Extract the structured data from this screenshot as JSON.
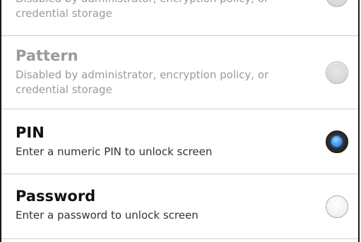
{
  "options": [
    {
      "title": "",
      "summary_line1": "Disabled by administrator, encryption policy, or",
      "summary_line2": "credential storage",
      "state": "disabled"
    },
    {
      "title": "Pattern",
      "summary_line1": "Disabled by administrator, encryption policy, or",
      "summary_line2": "credential storage",
      "state": "disabled"
    },
    {
      "title": "PIN",
      "summary_line1": "Enter a numeric PIN to unlock screen",
      "state": "selected"
    },
    {
      "title": "Password",
      "summary_line1": "Enter a password to unlock screen",
      "state": "unselected"
    }
  ],
  "colors": {
    "selected_radio_accent": "#3a9cf0",
    "disabled_text": "#9a9a9a",
    "divider": "#cfcfcf"
  },
  "icons": {
    "selected": "radio-selected-icon",
    "unselected": "radio-unselected-icon"
  }
}
